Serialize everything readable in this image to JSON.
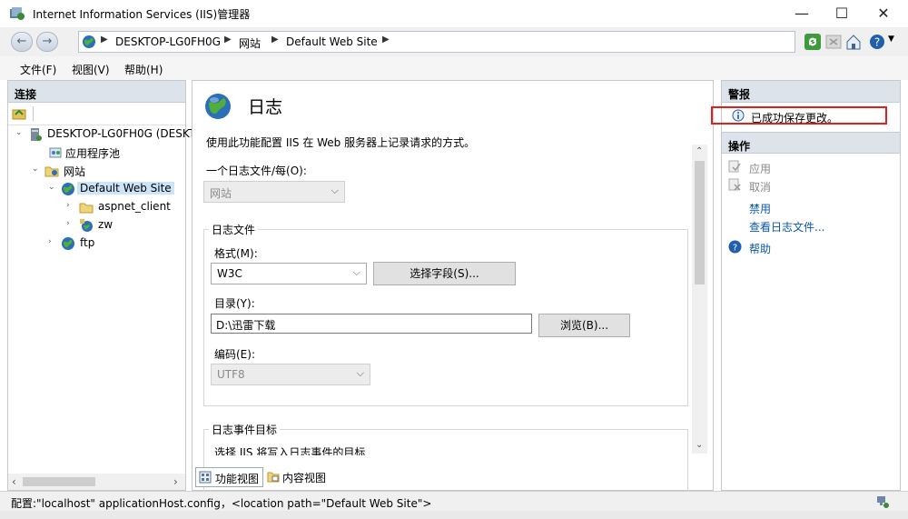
{
  "window": {
    "title": "Internet Information Services (IIS)管理器",
    "minimize": "—",
    "maximize": "☐",
    "close": "✕"
  },
  "address": {
    "back": "←",
    "forward": "→",
    "crumbs": [
      "DESKTOP-LG0FH0G",
      "网站",
      "Default Web Site"
    ],
    "sep": "▶"
  },
  "menu": [
    "文件(F)",
    "视图(V)",
    "帮助(H)"
  ],
  "connections": {
    "header": "连接",
    "tree": [
      {
        "label": "DESKTOP-LG0FH0G (DESKT",
        "icon": "server-icon"
      },
      {
        "label": "应用程序池",
        "icon": "app-pool-icon"
      },
      {
        "label": "网站",
        "icon": "sites-folder-icon"
      },
      {
        "label": "Default Web Site",
        "icon": "globe-icon"
      },
      {
        "label": "aspnet_client",
        "icon": "folder-icon"
      },
      {
        "label": "zw",
        "icon": "web-app-icon"
      },
      {
        "label": "ftp",
        "icon": "globe-icon"
      }
    ]
  },
  "feature": {
    "title": "日志",
    "description": "使用此功能配置 IIS 在 Web 服务器上记录请求的方式。",
    "per_label": "一个日志文件/每(O):",
    "per_value": "网站",
    "logfile_group": "日志文件",
    "format_label": "格式(M):",
    "format_value": "W3C",
    "select_fields_btn": "选择字段(S)...",
    "dir_label": "目录(Y):",
    "dir_value": "D:\\迅雷下载",
    "browse_btn": "浏览(B)...",
    "encoding_label": "编码(E):",
    "encoding_value": "UTF8",
    "event_group": "日志事件目标",
    "event_desc": "选择 IIS 将写入日志事件的目标"
  },
  "view_tabs": {
    "features": "功能视图",
    "content": "内容视图"
  },
  "alerts": {
    "header": "警报",
    "message": "已成功保存更改。"
  },
  "actions": {
    "header": "操作",
    "apply": "应用",
    "cancel": "取消",
    "disable": "禁用",
    "view_logs": "查看日志文件...",
    "help": "帮助"
  },
  "status": {
    "text": "配置:\"localhost\" applicationHost.config，<location path=\"Default Web Site\">"
  },
  "colors": {
    "accent": "#0b57a8",
    "alert_border": "#e0201a",
    "header_bg": "#dde3ea"
  }
}
